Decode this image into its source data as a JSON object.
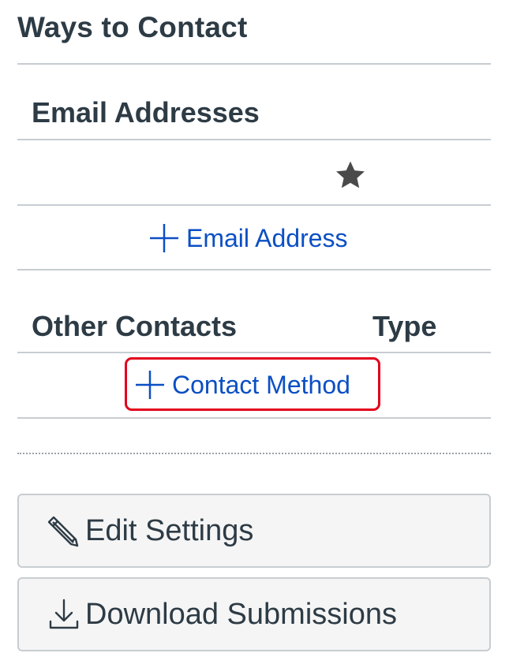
{
  "page": {
    "title": "Ways to Contact"
  },
  "email_section": {
    "heading": "Email Addresses",
    "addresses": [
      {
        "value": "",
        "is_default": true,
        "default_icon": "star-icon"
      }
    ],
    "add_label": "Email Address",
    "add_icon": "plus-icon"
  },
  "other_contacts": {
    "heading": "Other Contacts",
    "type_heading": "Type",
    "add_label": "Contact Method",
    "add_icon": "plus-icon",
    "highlight_color": "#e3001b"
  },
  "actions": {
    "edit_settings": {
      "label": "Edit Settings",
      "icon": "pencil-icon"
    },
    "download_submissions": {
      "label": "Download Submissions",
      "icon": "download-icon"
    }
  },
  "colors": {
    "link": "#0b4fc4",
    "text": "#2d3b45",
    "button_bg": "#f5f5f5",
    "border": "#c7cdd1"
  }
}
